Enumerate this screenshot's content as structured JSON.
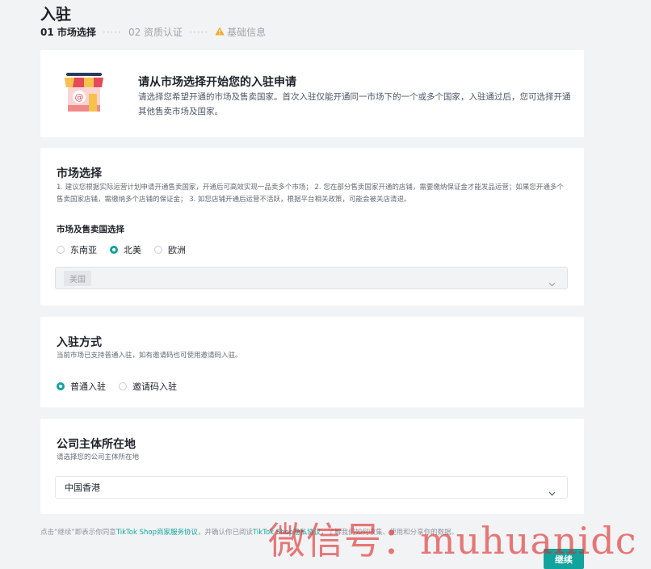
{
  "page": {
    "title": "入驻"
  },
  "steps": {
    "step1": "01 市场选择",
    "sep1": "·····",
    "step2": "02 资质认证",
    "sep2": "·····",
    "step3": "基础信息"
  },
  "intro": {
    "icon": "shop-storefront-icon",
    "title": "请从市场选择开始您的入驻申请",
    "desc": "请选择您希望开通的市场及售卖国家。首次入驻仅能开通同一市场下的一个或多个国家，入驻通过后，您可选择开通其他售卖市场及国家。"
  },
  "market": {
    "title": "市场选择",
    "desc": "1. 建议您根据实际运营计划申请开通售卖国家，开通后可高效实现一品卖多个市场； 2. 您在部分售卖国家开通的店铺，需要缴纳保证金才能发品运营；如果您开通多个售卖国家店铺，需缴纳多个店铺的保证金； 3. 如您店铺开通后运营不活跃，根据平台相关政策，可能会被关店清退。",
    "sub_label": "市场及售卖国选择",
    "options": [
      {
        "label": "东南亚",
        "checked": false
      },
      {
        "label": "北美",
        "checked": true
      },
      {
        "label": "欧洲",
        "checked": false
      }
    ],
    "country_tag": "美国"
  },
  "mode": {
    "title": "入驻方式",
    "desc": "当前市场已支持普通入驻，如有邀请码也可使用邀请码入驻。",
    "options": [
      {
        "label": "普通入驻",
        "checked": true
      },
      {
        "label": "邀请码入驻",
        "checked": false
      }
    ]
  },
  "company": {
    "title": "公司主体所在地",
    "desc": "请选择您的公司主体所在地",
    "value": "中国香港"
  },
  "footer": {
    "note_prefix": "点击“继续”即表示你同意",
    "link1": "TikTok Shop商家服务协议",
    "note_mid": "，并确认你已阅读",
    "link2": "TikTok Shop隐私协议",
    "note_suffix": "，了解我们如何收集、使用和分享你的数据。",
    "continue_label": "继续"
  },
  "watermark": "微信号：muhuanidc",
  "colors": {
    "accent": "#13a39d",
    "warning": "#f5a623",
    "background": "#f2f3f5"
  }
}
